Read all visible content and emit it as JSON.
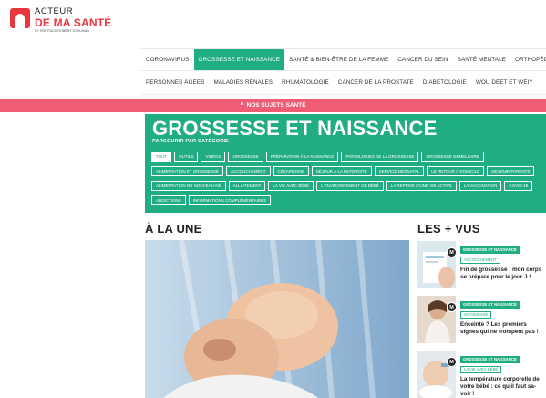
{
  "logo": {
    "line1": "ACTEUR",
    "line2": "DE MA SANTÉ",
    "line3": "BY HÔPITAUX ROBERT SCHUMAN"
  },
  "nav_primary": [
    {
      "label": "CORONAVIRUS"
    },
    {
      "label": "GROSSESSE ET NAISSANCE",
      "active": true
    },
    {
      "label": "SANTÉ & BIEN-ÊTRE DE LA FEMME"
    },
    {
      "label": "CANCER DU SEIN"
    },
    {
      "label": "SANTÉ MENTALE"
    },
    {
      "label": "ORTHOPÉDIE"
    }
  ],
  "nav_secondary": [
    {
      "label": "PERSONNES ÂGÉES"
    },
    {
      "label": "MALADIES RÉNALES"
    },
    {
      "label": "RHUMATOLOGIE"
    },
    {
      "label": "CANCER DE LA PROSTATE"
    },
    {
      "label": "DIABÉTOLOGIE"
    },
    {
      "label": "WOU DEET ET WÉI?"
    }
  ],
  "subjects_bar": {
    "label": "NOS SUJETS SANTÉ"
  },
  "hero": {
    "title": "GROSSESSE ET NAISSANCE",
    "subtitle": "PARCOURIR PAR CATÉGORIE",
    "categories": [
      {
        "label": "TOUT",
        "active": true
      },
      {
        "label": "OUTILS"
      },
      {
        "label": "VIDÉOS"
      },
      {
        "label": "GROSSESSE"
      },
      {
        "label": "PRÉPARATION À LA NAISSANCE"
      },
      {
        "label": "PATHOLOGIES DE LA GROSSESSE"
      },
      {
        "label": "GROSSESSE GÉMELLAIRE"
      },
      {
        "label": "ALIMENTATION ET GROSSESSE"
      },
      {
        "label": "ACCOUCHEMENT"
      },
      {
        "label": "CÉSARIENNE"
      },
      {
        "label": "SÉJOUR À LA MATERNITÉ"
      },
      {
        "label": "SERVICE NÉONATAL"
      },
      {
        "label": "LE RETOUR À DOMICILE"
      },
      {
        "label": "DEVENIR PARENTS"
      },
      {
        "label": "ALIMENTATION DU NOUVEAU-NÉ"
      },
      {
        "label": "ALLAITEMENT"
      },
      {
        "label": "LA VIE AVEC BÉBÉ"
      },
      {
        "label": "L'ENVIRONNEMENT DE BÉBÉ"
      },
      {
        "label": "LA REPRISE D'UNE VIE ACTIVE"
      },
      {
        "label": "LA VACCINATION"
      },
      {
        "label": "COVID-19"
      },
      {
        "label": "ADDICTIONS"
      },
      {
        "label": "INFORMATIONS COMPLÉMENTAIRES"
      }
    ]
  },
  "sections": {
    "featured": "À LA UNE",
    "popular": "LES + VUS"
  },
  "popular_articles": [
    {
      "badge": "M",
      "category": "GROSSESSE ET NAISSANCE",
      "subcategory": "ACCOUCHEMENT",
      "title": "Fin de grossesse : mon corps se prépare pour le jour J !"
    },
    {
      "badge": "M",
      "category": "GROSSESSE ET NAISSANCE",
      "subcategory": "GROSSESSE",
      "title": "Enceinte ? Les premiers signes qui ne trompent pas !"
    },
    {
      "badge": "M",
      "category": "GROSSESSE ET NAISSANCE",
      "subcategory": "LA VIE AVEC BÉBÉ",
      "title": "La température corporelle de votre bébé : ce qu'il faut sa-voir !"
    }
  ]
}
